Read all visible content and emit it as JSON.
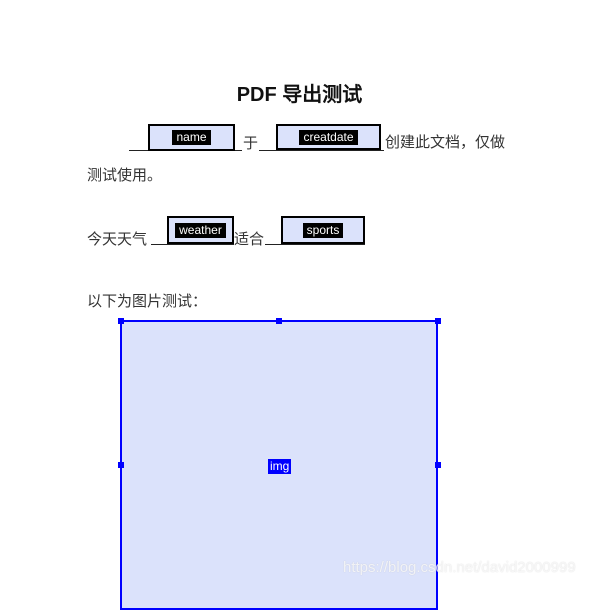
{
  "document": {
    "title": "PDF 导出测试",
    "paragraph1": {
      "field_name": "name",
      "text_yu": "于",
      "field_createdate": "creatdate",
      "text_after": "创建此文档，仅做",
      "line2": "测试使用。"
    },
    "paragraph2": {
      "text_before": "今天天气",
      "field_weather": "weather",
      "text_middle": "适合",
      "field_sports": "sports"
    },
    "paragraph3": {
      "text": "以下为图片测试："
    },
    "image_field": {
      "label": "img"
    }
  },
  "watermark": "https://blog.csdn.net/david2000999",
  "colors": {
    "field_fill": "#dbe2fb",
    "field_border": "#000000",
    "selection_blue": "#0000ff"
  }
}
